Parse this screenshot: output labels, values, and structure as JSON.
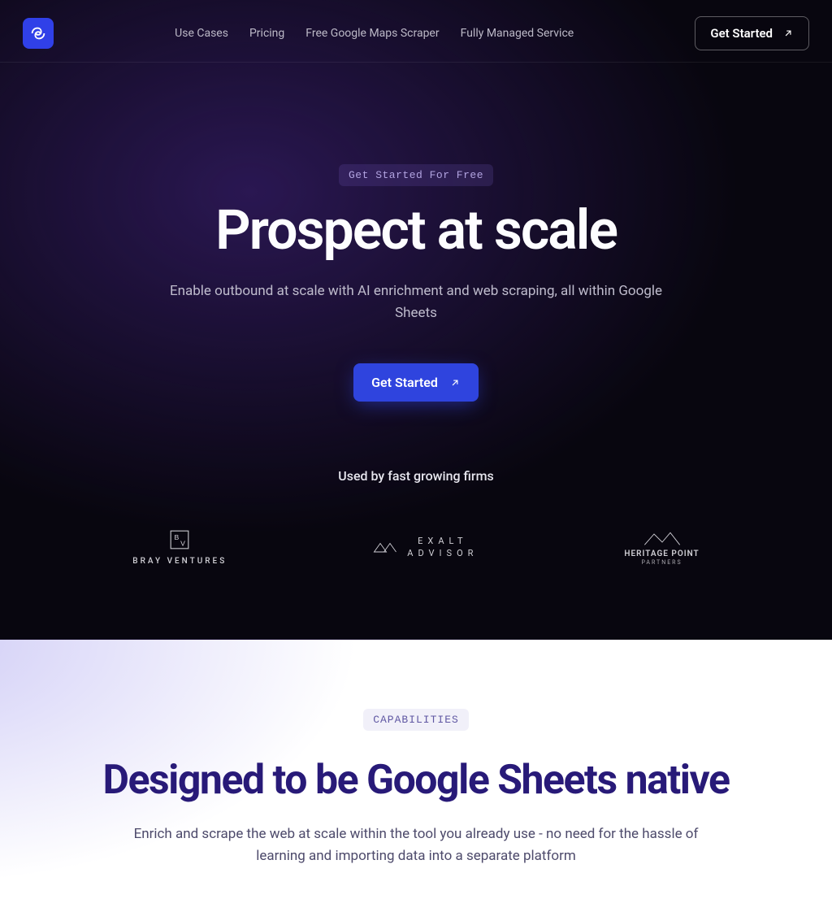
{
  "nav": {
    "links": [
      "Use Cases",
      "Pricing",
      "Free Google Maps Scraper",
      "Fully Managed Service"
    ],
    "cta_label": "Get Started"
  },
  "hero": {
    "badge": "Get Started For Free",
    "title": "Prospect at scale",
    "subtitle": "Enable outbound at scale with AI enrichment and web scraping, all within Google Sheets",
    "cta_label": "Get Started",
    "social_proof": "Used by fast growing firms",
    "clients": {
      "bray": "BRAY VENTURES",
      "exalt_line1": "EXALT",
      "exalt_line2": "ADVISOR",
      "heritage_line1": "HERITAGE POINT",
      "heritage_line2": "PARTNERS"
    }
  },
  "caps": {
    "badge": "CAPABILITIES",
    "title": "Designed to be Google Sheets native",
    "subtitle": "Enrich and scrape the web at scale within the tool you already use - no need for the hassle of learning and importing data into a separate platform"
  }
}
